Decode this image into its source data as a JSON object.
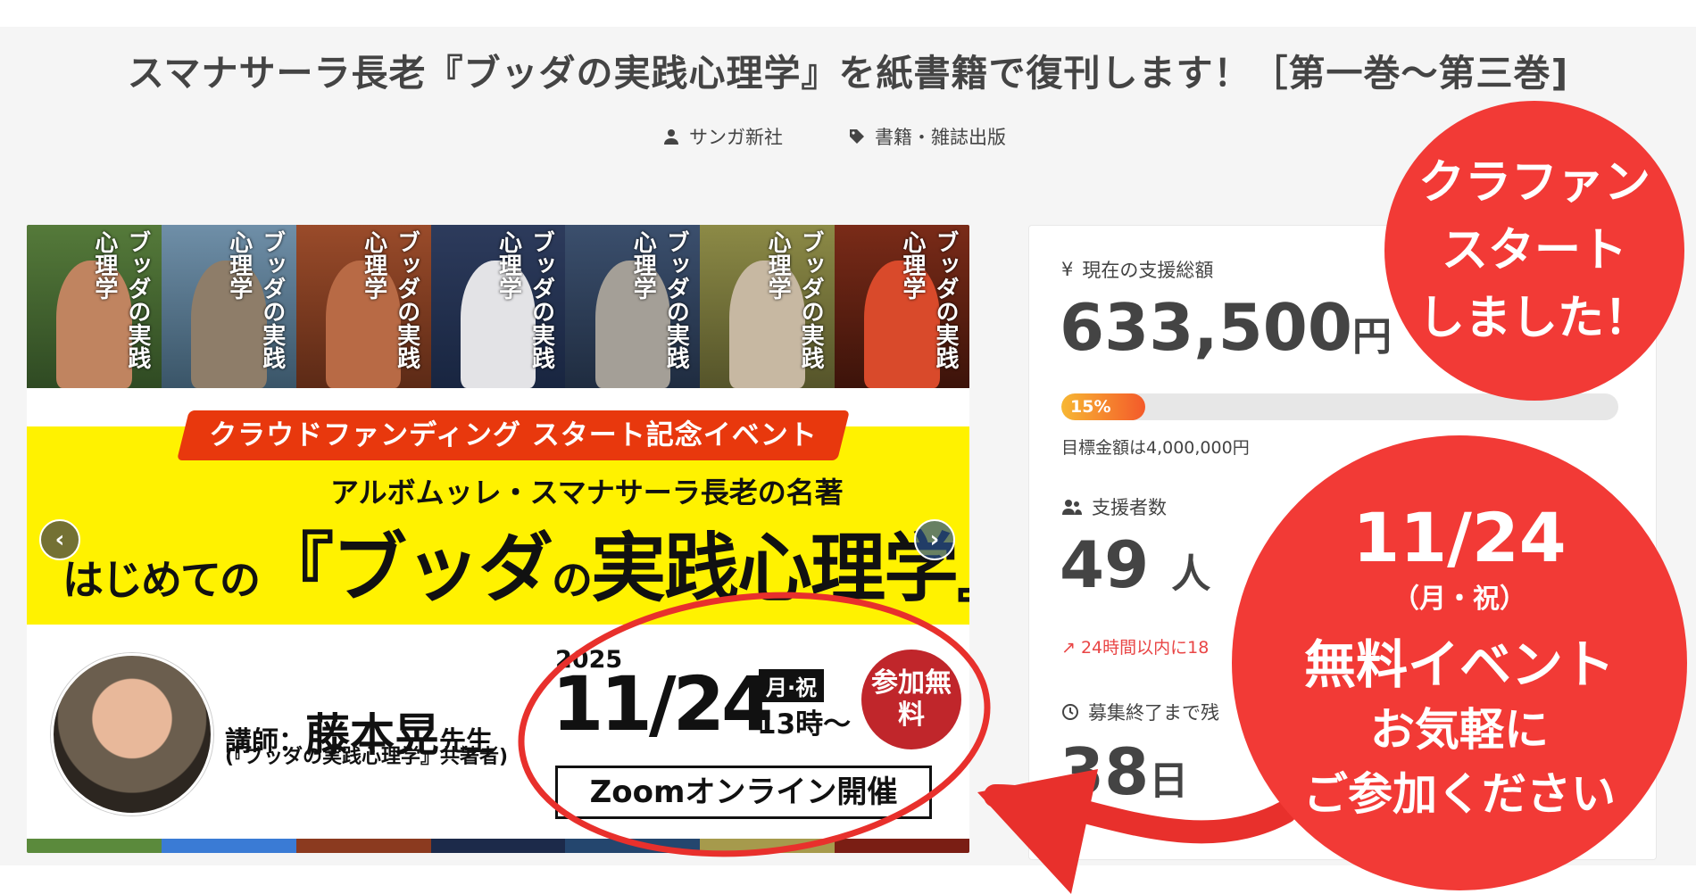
{
  "page": {
    "title": "スマナサーラ長老『ブッダの実践心理学』を紙書籍で復刊します！［第一巻〜第三巻]",
    "author": "サンガ新社",
    "category": "書籍・雑誌出版"
  },
  "banner": {
    "book_title": "ブッダの実践心理学",
    "event_tag": "クラウドファンディング スタート記念イベント",
    "subtitle": "アルボムッレ・スマナサーラ長老の名著",
    "title_prefix": "はじめての",
    "title_open": "『",
    "title_main": "ブッダ",
    "title_no": "の",
    "title_rest": "実践心理学",
    "title_close": "』",
    "speaker_prefix": "講師：",
    "speaker_name": "藤本晃",
    "speaker_suffix": "先生",
    "speaker_note": "(『ブッダの実践心理学』共著者)",
    "year": "2025",
    "date": "11/24",
    "day": "月·祝",
    "time": "13時〜",
    "free_badge": "参加無料",
    "format": "Zoomオンライン開催",
    "prev": "‹",
    "next": "›"
  },
  "stats": {
    "currency_icon": "¥",
    "amount_label": "現在の支援総額",
    "amount": "633,500",
    "amount_unit": "円",
    "progress_label": "15%",
    "progress_fraction": 0.15,
    "goal_text": "目標金額は4,000,000円",
    "supporters_label": "支援者数",
    "supporters": "49",
    "supporters_unit": "人",
    "trend_text": "24時間以内に18",
    "remaining_label": "募集終了まで残",
    "remaining": "38",
    "remaining_unit": "日"
  },
  "bubbles": {
    "start_line1": "クラファン",
    "start_line2": "スタート",
    "start_line3": "しました！",
    "event_date": "11/24",
    "event_day": "（月・祝）",
    "event_line3": "無料イベント",
    "event_line4": "お気軽に",
    "event_line5": "ご参加ください"
  },
  "colors": {
    "accent_red": "#f23a36",
    "progress_start": "#f7b733",
    "progress_end": "#f45a2a",
    "banner_yellow": "#fff200"
  }
}
